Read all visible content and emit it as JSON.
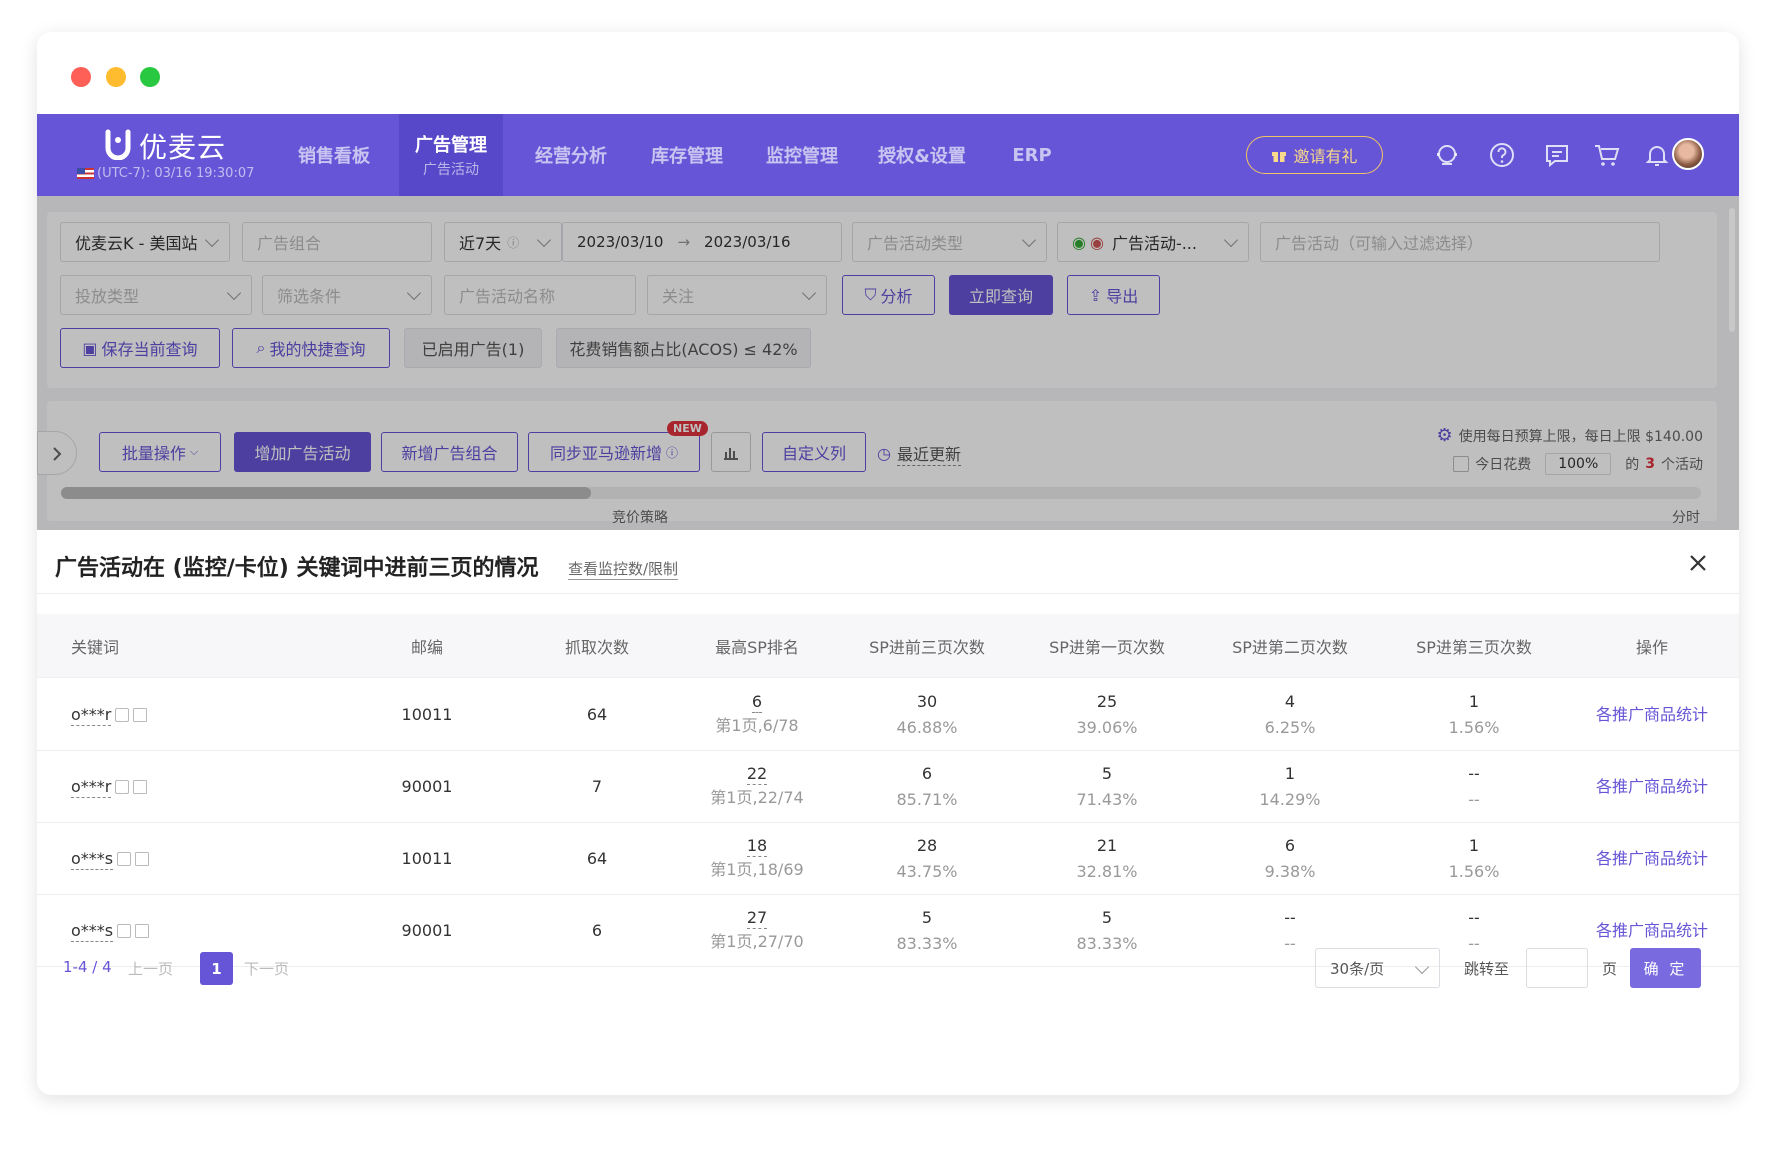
{
  "brand": {
    "name": "优麦云",
    "timezone": "(UTC-7): 03/16 19:30:07"
  },
  "nav": {
    "items": [
      "销售看板",
      "广告管理",
      "经营分析",
      "库存管理",
      "监控管理",
      "授权&设置",
      "ERP"
    ],
    "active_sub": "广告活动",
    "invite": "邀请有礼"
  },
  "filters": {
    "shop": "优麦云K - 美国站",
    "ad_group_placeholder": "广告组合",
    "date_range": "近7天",
    "date_start": "2023/03/10",
    "date_end": "2023/03/16",
    "campaign_type_placeholder": "广告活动类型",
    "campaign_status": "广告活动-...",
    "campaign_filter_placeholder": "广告活动（可输入过滤选择）",
    "delivery_type_placeholder": "投放类型",
    "condition_placeholder": "筛选条件",
    "campaign_name_placeholder": "广告活动名称",
    "follow_placeholder": "关注",
    "analyze_label": "分析",
    "query_label": "立即查询",
    "export_label": "导出",
    "save_query_label": "保存当前查询",
    "quick_query_label": "我的快捷查询",
    "enabled_tag": "已启用广告(1)",
    "acos_tag": "花费销售额占比(ACOS) ≤ 42%"
  },
  "toolbar": {
    "batch_label": "批量操作",
    "add_campaign_label": "增加广告活动",
    "add_group_label": "新增广告组合",
    "sync_label": "同步亚马逊新增",
    "new_badge": "NEW",
    "custom_cols_label": "自定义列",
    "recent_update_label": "最近更新",
    "budget_text": "使用每日预算上限，每日上限 $140.00",
    "today_spend_label": "今日花费",
    "today_spend_value": "100%",
    "of_label": "的",
    "active_count": "3",
    "active_suffix": "个活动",
    "col_hint_left": "竞价策略",
    "col_hint_right": "分时"
  },
  "panel": {
    "title": "广告活动在 (监控/卡位) 关键词中进前三页的情况",
    "link": "查看监控数/限制",
    "columns": [
      "关键词",
      "邮编",
      "抓取次数",
      "最高SP排名",
      "SP进前三页次数",
      "SP进第一页次数",
      "SP进第二页次数",
      "SP进第三页次数",
      "操作"
    ],
    "rows": [
      {
        "keyword": "o***r",
        "zip": "10011",
        "fetches": "64",
        "rank": "6",
        "rank_detail": "第1页,6/78",
        "top3": "30",
        "top3_pct": "46.88%",
        "p1": "25",
        "p1_pct": "39.06%",
        "p2": "4",
        "p2_pct": "6.25%",
        "p3": "1",
        "p3_pct": "1.56%",
        "action": "各推广商品统计"
      },
      {
        "keyword": "o***r",
        "zip": "90001",
        "fetches": "7",
        "rank": "22",
        "rank_detail": "第1页,22/74",
        "top3": "6",
        "top3_pct": "85.71%",
        "p1": "5",
        "p1_pct": "71.43%",
        "p2": "1",
        "p2_pct": "14.29%",
        "p3": "--",
        "p3_pct": "--",
        "action": "各推广商品统计"
      },
      {
        "keyword": "o***s",
        "zip": "10011",
        "fetches": "64",
        "rank": "18",
        "rank_detail": "第1页,18/69",
        "top3": "28",
        "top3_pct": "43.75%",
        "p1": "21",
        "p1_pct": "32.81%",
        "p2": "6",
        "p2_pct": "9.38%",
        "p3": "1",
        "p3_pct": "1.56%",
        "action": "各推广商品统计"
      },
      {
        "keyword": "o***s",
        "zip": "90001",
        "fetches": "6",
        "rank": "27",
        "rank_detail": "第1页,27/70",
        "top3": "5",
        "top3_pct": "83.33%",
        "p1": "5",
        "p1_pct": "83.33%",
        "p2": "--",
        "p2_pct": "--",
        "p3": "--",
        "p3_pct": "--",
        "action": "各推广商品统计"
      }
    ]
  },
  "pager": {
    "range": "1-4 / 4",
    "prev": "上一页",
    "current": "1",
    "next": "下一页",
    "page_size": "30条/页",
    "jump_label": "跳转至",
    "page_unit": "页",
    "confirm": "确 定"
  },
  "colors": {
    "brand": "#6655d6",
    "active_nav": "#5747c9",
    "invite": "#f0c565"
  }
}
